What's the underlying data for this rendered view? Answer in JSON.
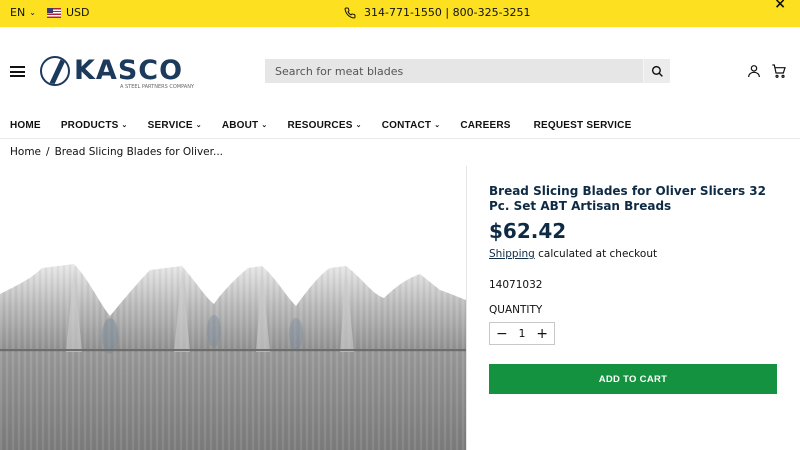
{
  "topbar": {
    "language": "EN",
    "currency": "USD",
    "phone": "314-771-1550 | 800-325-3251"
  },
  "header": {
    "logo_text": "KASCO",
    "logo_subtitle": "A STEEL PARTNERS COMPANY",
    "search_placeholder": "Search for meat blades"
  },
  "nav": {
    "items": [
      {
        "label": "HOME",
        "dropdown": false
      },
      {
        "label": "PRODUCTS",
        "dropdown": true
      },
      {
        "label": "SERVICE",
        "dropdown": true
      },
      {
        "label": "ABOUT",
        "dropdown": true
      },
      {
        "label": "RESOURCES",
        "dropdown": true
      },
      {
        "label": "CONTACT",
        "dropdown": true
      },
      {
        "label": "CAREERS",
        "dropdown": false
      },
      {
        "label": "REQUEST SERVICE",
        "dropdown": false
      }
    ]
  },
  "breadcrumb": {
    "home": "Home",
    "separator": "/",
    "current": "Bread Slicing Blades for Oliver..."
  },
  "product": {
    "title": "Bread Slicing Blades for Oliver Slicers 32 Pc. Set ABT Artisan Breads",
    "price": "$62.42",
    "shipping_link": "Shipping",
    "shipping_text": " calculated at checkout",
    "sku": "14071032",
    "quantity_label": "QUANTITY",
    "quantity": "1",
    "add_to_cart": "ADD TO CART"
  },
  "colors": {
    "topbar_bg": "#fde120",
    "brand_navy": "#0f2a45",
    "cart_green": "#15923f"
  }
}
